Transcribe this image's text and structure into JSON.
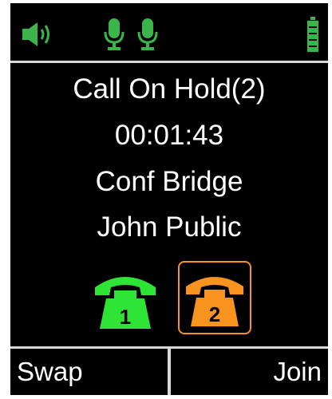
{
  "status_bar": {
    "icons": [
      "speaker-icon",
      "microphone-icon",
      "microphone-icon",
      "battery-icon"
    ],
    "icon_color": "#3bb54a",
    "battery_level": 1.0
  },
  "call": {
    "status": "Call On Hold(2)",
    "timer": "00:01:43",
    "line1_name": "Conf Bridge",
    "line2_name": "John Public"
  },
  "lines": [
    {
      "number": "1",
      "color": "#2ee536",
      "icon": "phone-icon",
      "selected": false
    },
    {
      "number": "2",
      "color": "#f7931e",
      "icon": "phone-icon",
      "selected": true
    }
  ],
  "softkeys": {
    "left": "Swap",
    "right": "Join"
  }
}
